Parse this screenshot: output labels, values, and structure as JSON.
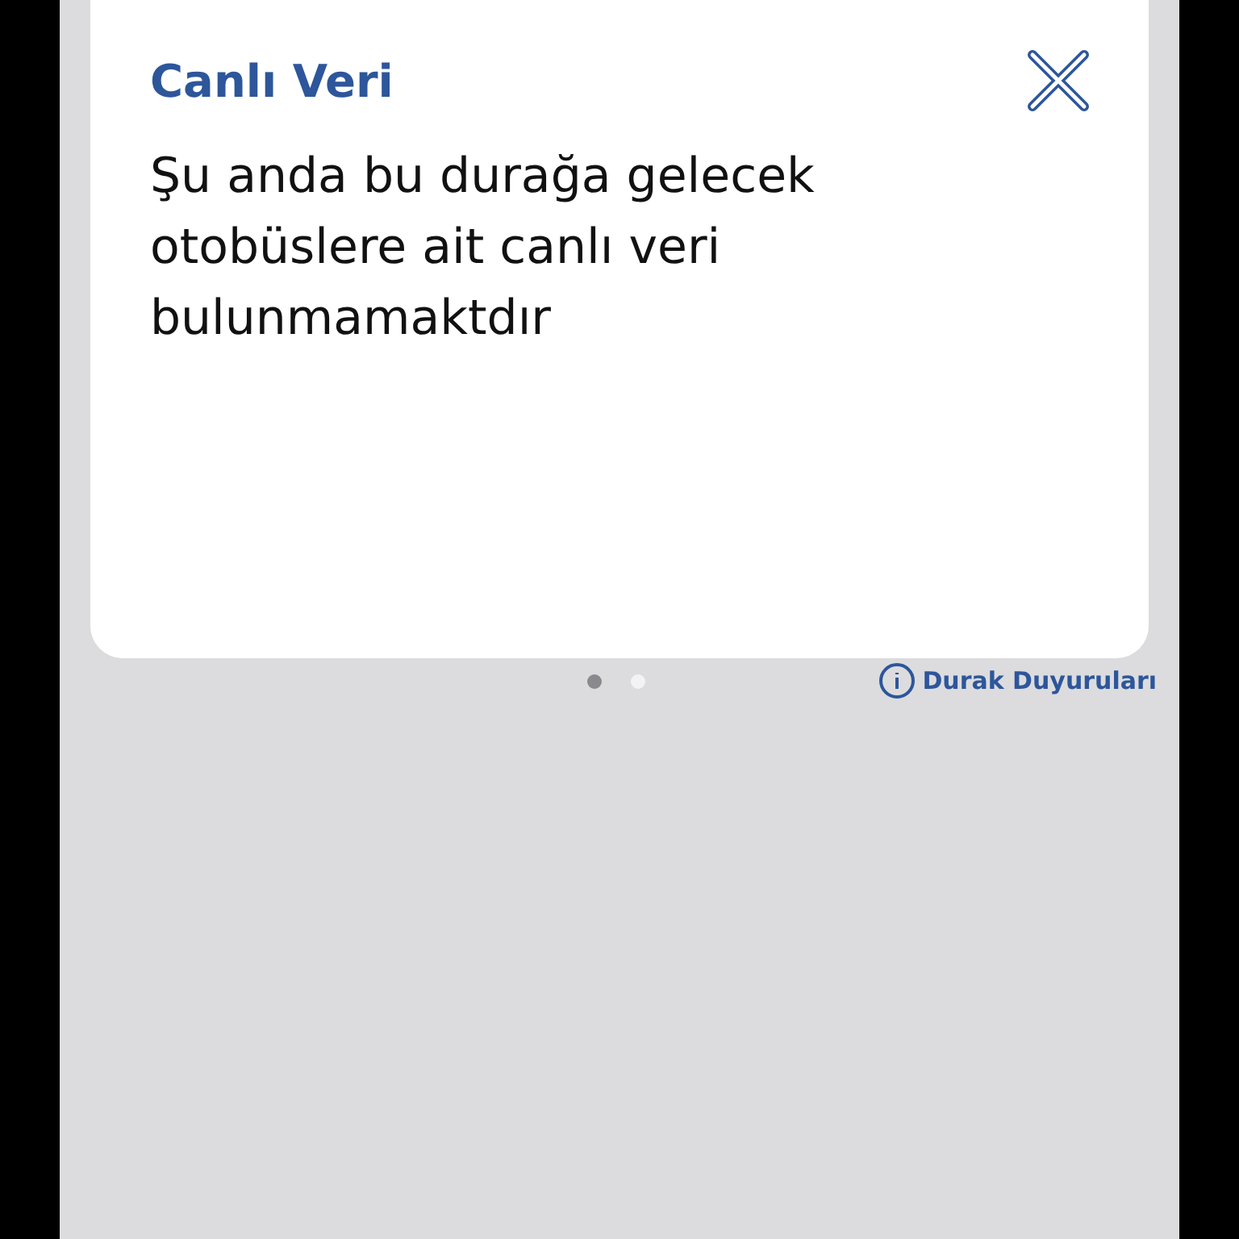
{
  "dialog": {
    "title": "Canlı Veri",
    "message": "Şu anda bu durağa gelecek otobüslere ait canlı veri bulunmamaktdır"
  },
  "pager": [
    {
      "selected": true
    },
    {
      "selected": false
    }
  ],
  "announcements_link": {
    "label": "Durak Duyuruları"
  }
}
